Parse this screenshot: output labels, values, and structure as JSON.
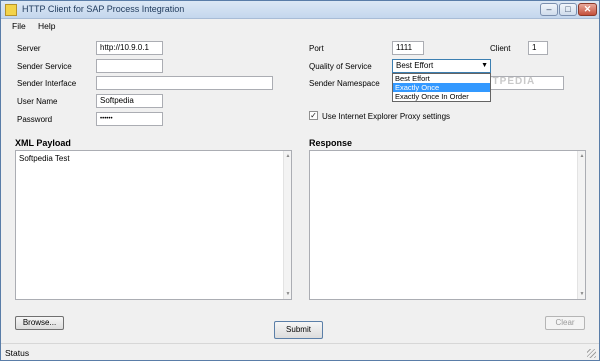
{
  "window": {
    "title": "HTTP Client for SAP Process Integration"
  },
  "menu": {
    "file": "File",
    "help": "Help"
  },
  "form": {
    "server_label": "Server",
    "server_value": "http://10.9.0.1",
    "sender_service_label": "Sender Service",
    "sender_service_value": "",
    "sender_interface_label": "Sender Interface",
    "sender_interface_value": "",
    "user_name_label": "User Name",
    "user_name_value": "Softpedia",
    "password_label": "Password",
    "password_value": "••••••",
    "port_label": "Port",
    "port_value": "1111",
    "client_label": "Client",
    "client_value": "1",
    "qos_label": "Quality of Service",
    "qos_value": "Best Effort",
    "qos_options": [
      "Best Effort",
      "Exactly Once",
      "Exactly Once In Order"
    ],
    "qos_highlighted": "Exactly Once",
    "sender_namespace_label": "Sender Namespace",
    "sender_namespace_value": "",
    "proxy_label": "Use Internet Explorer Proxy settings",
    "proxy_checked": true
  },
  "payload": {
    "title": "XML Payload",
    "content": "Softpedia Test"
  },
  "response": {
    "title": "Response",
    "content": ""
  },
  "buttons": {
    "browse": "Browse...",
    "submit": "Submit",
    "clear": "Clear"
  },
  "status": {
    "text": "Status"
  },
  "watermark": "SOFTPEDIA"
}
